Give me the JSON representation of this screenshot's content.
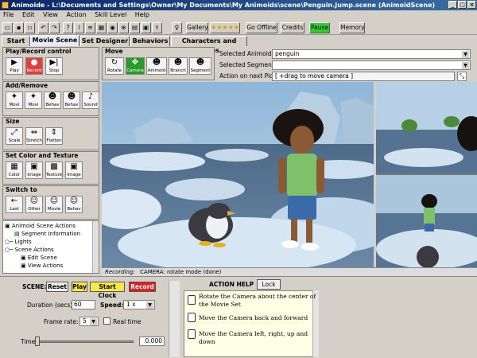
{
  "window": {
    "title": "Animoide - L:\\Documents and Settings\\Owner\\My Documents\\My Animoids\\scene\\Penguin.Jump.scene (AnimoidScene)"
  },
  "menu": [
    "File",
    "Edit",
    "View",
    "Action",
    "Skill Level",
    "Help"
  ],
  "toolbar": {
    "gallery_label": "Gallery",
    "stars": "★★★★★",
    "go_offline": "Go Offline",
    "credits": "Credits",
    "pause": "Pause",
    "memory": "Memory"
  },
  "tabs": [
    "Start",
    "Movie Scene",
    "Set Designer",
    "Behaviors",
    "Characters and Props"
  ],
  "left": {
    "play_record": {
      "title": "Play/Record control",
      "tools": [
        {
          "label": "Play",
          "icon": "▶"
        },
        {
          "label": "Record",
          "icon": "●"
        },
        {
          "label": "Stop",
          "icon": "▶|"
        }
      ]
    },
    "add_remove": {
      "title": "Add/Remove",
      "tools": [
        {
          "label": "Movi",
          "icon": "✦"
        },
        {
          "label": "Movi",
          "icon": "✦"
        },
        {
          "label": "Behav",
          "icon": "☻"
        },
        {
          "label": "Behav",
          "icon": "☻"
        },
        {
          "label": "Sound",
          "icon": "♪"
        }
      ]
    },
    "size": {
      "title": "Size",
      "tools": [
        {
          "label": "Scale",
          "icon": "⤢"
        },
        {
          "label": "Stretch",
          "icon": "⇔"
        },
        {
          "label": "Flatten",
          "icon": "⇕"
        }
      ]
    },
    "color_texture": {
      "title": "Set Color and Texture",
      "tools": [
        {
          "label": "Color",
          "icon": "▦"
        },
        {
          "label": "Image",
          "icon": "▣"
        },
        {
          "label": "Texture",
          "icon": "▩"
        },
        {
          "label": "Image",
          "icon": "▣"
        }
      ]
    },
    "switch_to": {
      "title": "Switch to",
      "tools": [
        {
          "label": "Last",
          "icon": "←"
        },
        {
          "label": "Other",
          "icon": "☺"
        },
        {
          "label": "Movie",
          "icon": "☺"
        },
        {
          "label": "Behav",
          "icon": "☺"
        }
      ]
    },
    "tree": [
      {
        "label": "Animoid Scene Actions",
        "level": 0
      },
      {
        "label": "Segment Information",
        "level": 1
      },
      {
        "label": "Lights",
        "level": 0
      },
      {
        "label": "Scene Actions",
        "level": 0
      },
      {
        "label": "Edit Scene",
        "level": 2
      },
      {
        "label": "View Actions",
        "level": 2
      }
    ]
  },
  "move": {
    "title": "Move",
    "tools": [
      {
        "label": "Rotate",
        "icon": "↻"
      },
      {
        "label": "Camera",
        "icon": "✥"
      },
      {
        "label": "Animoid",
        "icon": "☻"
      },
      {
        "label": "Branch",
        "icon": "☻"
      },
      {
        "label": "Segment",
        "icon": "☻"
      }
    ]
  },
  "selection": {
    "selected_animoid_label": "Selected Animoid:",
    "selected_animoid_value": "penguin",
    "selected_segment_label": "Selected Segment:",
    "selected_segment_value": "",
    "action_label": "Action on next Pick:",
    "action_value": "[ +drag to move camera ]"
  },
  "status": {
    "recording_label": "Recording:",
    "message": "CAMERA: rotate mode (done)"
  },
  "scene_controls": {
    "scene_label": "SCENE:",
    "reset": "Reset",
    "play": "Play",
    "start_clock": "Start Clock",
    "record": "Record",
    "duration_label": "Duration (secs):",
    "duration_value": "60",
    "speed_label": "Speed:",
    "speed_value": "1 x",
    "frame_rate_label": "Frame rate:",
    "frame_rate_value": "5",
    "realtime_label": "Real time",
    "time_label": "Time:",
    "time_value": "0.000",
    "time_progress": 0.0
  },
  "action_help": {
    "title": "ACTION HELP",
    "lock": "Lock",
    "items": [
      "Rotate the Camera about the center of the Movie Set",
      "Move the Camera back and forward",
      "Move the Camera left, right, up and down"
    ]
  },
  "colors": {
    "title_start": "#0a246a",
    "pause_green": "#33cc33",
    "play_yellow": "#f6e84a",
    "record_red": "#e02020",
    "sky": "#9fc4e0",
    "water": "#5b7898",
    "ice": "#c8dcea"
  }
}
